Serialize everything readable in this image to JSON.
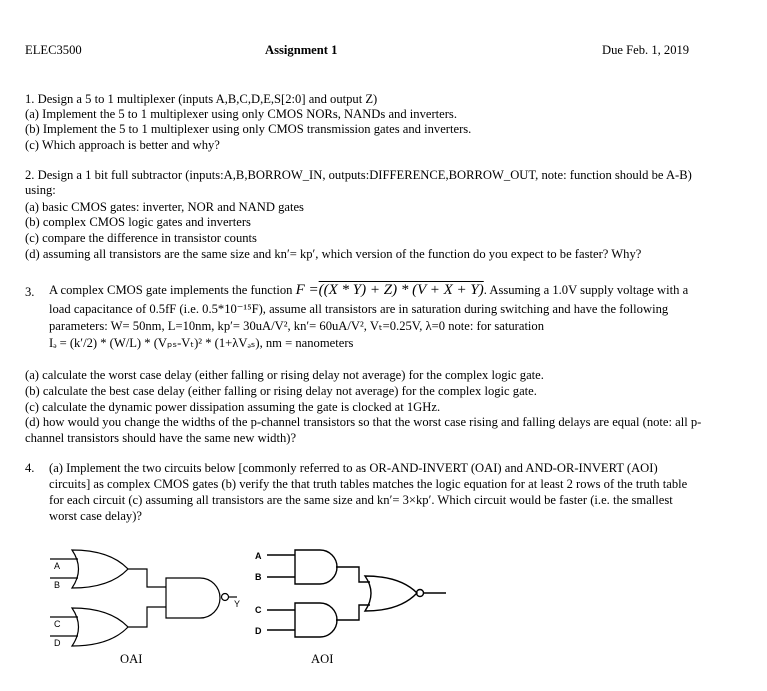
{
  "header": {
    "course": "ELEC3500",
    "title": "Assignment 1",
    "due": "Due Feb. 1, 2019"
  },
  "q1": {
    "lines": [
      "1.  Design a 5 to 1 multiplexer (inputs A,B,C,D,E,S[2:0] and output Z)",
      "(a) Implement the 5 to 1 multiplexer using only CMOS NORs, NANDs and inverters.",
      "(b) Implement the 5 to 1 multiplexer using only CMOS transmission gates and inverters.",
      "(c) Which approach is better and why?"
    ]
  },
  "q2": {
    "lines": [
      "2.  Design a 1 bit full subtractor (inputs:A,B,BORROW_IN, outputs:DIFFERENCE,BORROW_OUT, note: function should be A-B)",
      "using:",
      "(a) basic CMOS gates: inverter, NOR and NAND gates",
      "(b) complex CMOS logic gates and inverters",
      "(c) compare the difference in transistor counts",
      "(d) assuming all transistors are the same size and kn′= kp′, which version of the function  do you expect to be faster?  Why?"
    ]
  },
  "q3": {
    "number": "3.",
    "intro": "A complex CMOS gate implements the function",
    "function_lhs": "F =",
    "function_rhs": "((X * Y) + Z) * (V + X + Y)",
    "after": ". Assuming a 1.0V supply voltage with a",
    "line2": "load capacitance of 0.5fF (i.e. 0.5*10⁻¹⁵F), assume all transistors are in saturation during switching and have the following",
    "line3": "parameters: W= 50nm, L=10nm, kp′= 30uA/V², kn′= 60uA/V²,  Vₜ=0.25V, λ=0  note: for saturation",
    "line4": "Iₔ = (k′/2) * (W/L) * (Vₚₛ-Vₜ)² * (1+λVₔₛ), nm = nanometers",
    "parts": [
      "(a) calculate the worst case delay (either falling or rising delay not average) for the complex logic gate.",
      "(b) calculate the best case delay (either falling or rising delay not average) for the complex logic gate.",
      "(c) calculate the dynamic power dissipation assuming the gate is clocked at 1GHz.",
      "(d) how would you change the widths of the p-channel transistors so that the worst case rising and falling delays are equal (note: all p-",
      "channel transistors should have the same new width)?"
    ]
  },
  "q4": {
    "number": "4.",
    "lines": [
      "(a) Implement the two circuits below [commonly referred to as OR-AND-INVERT (OAI) and AND-OR-INVERT (AOI)",
      "circuits] as complex CMOS gates  (b) verify the that truth tables matches the logic equation for at least 2 rows of the truth table",
      "for each circuit (c) assuming all transistors are the same size and kn′= 3×kp′.  Which circuit would be faster (i.e. the smallest",
      "worst case delay)?"
    ]
  },
  "figures": {
    "oai": {
      "caption": "OAI",
      "inputs": [
        "A",
        "B",
        "C",
        "D"
      ],
      "output": "Y"
    },
    "aoi": {
      "caption": "AOI",
      "inputs": [
        "A",
        "B",
        "C",
        "D"
      ]
    }
  }
}
